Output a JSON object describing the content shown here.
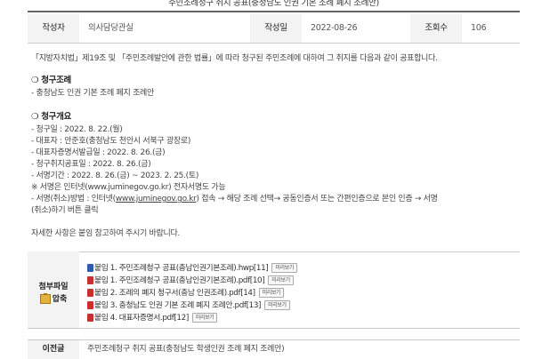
{
  "title": "주민조례청구 취지 공표(충청남도 인권 기본 조례 폐지 조례안)",
  "meta": {
    "author_label": "작성자",
    "author": "의사담당관실",
    "date_label": "작성일",
    "date": "2022-08-26",
    "views_label": "조회수",
    "views": "106"
  },
  "content": {
    "intro": "「지방자치법」제19조 및 「주민조례발안에 관한 법률」에 따라 청구된 주민조례에 대하여 그 취지를 다음과 같이 공표합니다.",
    "section1_title": "❍ 청구조례",
    "section1_item": "- 충청남도 인권 기본 조례 폐지 조례안",
    "section2_title": "❍ 청구개요",
    "items": [
      "- 청구일 : 2022. 8. 22.(월)",
      "- 대표자 : 안준호(충청남도 천안시 서북구 광장로)",
      "- 대표자증명서발급일 : 2022. 8. 26.(금)",
      "- 청구취지공표일 : 2022. 8. 26.(금)",
      "- 서명기간 : 2022. 8. 26.(금) ~ 2023. 2. 25.(토)",
      "※ 서명은 인터넷(www.juminegov.go.kr) 전자서명도 가능"
    ],
    "method_prefix": "- 서명(취소)방법 : 인터넷(",
    "method_link": "www.juminegov.go.kr",
    "method_suffix": ") 접속 → 해당 조례 선택→ 공동인증서 또는 간편인증으로 본인 인증 → 서명",
    "method_line2": "(취소)하기 버튼 클릭",
    "footer_note": "자세한 사항은 붙임 참고하여 주시기 바랍니다."
  },
  "attachments": {
    "label": "첨부파일",
    "zip_label": "압축",
    "preview_label": "미리보기",
    "files": [
      "붙임 1. 주민조례청구 공표(충남인권기본조례).hwp[11]",
      "붙임 1. 주민조례청구 공표(충남인권기본조례).pdf[10]",
      "붙임 2. 조례의 폐지 청구서(충남 인권조례).pdf[14]",
      "붙임 3. 충청남도 인권 기본 조례 폐지 조례안.pdf[13]",
      "붙임 4. 대표자증명서.pdf[12]"
    ]
  },
  "prev": {
    "label": "이전글",
    "title": "주민조례청구 취지 공표(충청남도 학생인권 조례 폐지 조례안)"
  }
}
